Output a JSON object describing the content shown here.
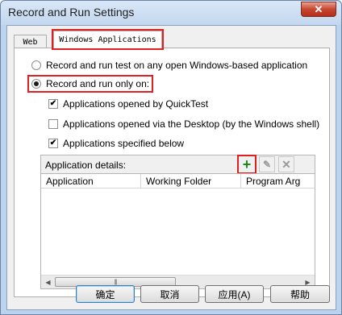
{
  "window": {
    "title": "Record and Run Settings",
    "close_glyph": "✕"
  },
  "tabs": [
    {
      "label": "Web"
    },
    {
      "label": "Windows Applications"
    }
  ],
  "options": {
    "radio_any": "Record and run test on any open Windows-based application",
    "radio_only": "Record and run only on:",
    "check_quicktest": "Applications opened by QuickTest",
    "check_desktop": "Applications opened via the Desktop (by the Windows shell)",
    "check_specified": "Applications specified below",
    "check_quicktest_checked": true,
    "check_desktop_checked": false,
    "check_specified_checked": true,
    "selected_radio": "only"
  },
  "details": {
    "label": "Application details:",
    "columns": [
      "Application",
      "Working Folder",
      "Program Arg"
    ],
    "rows": []
  },
  "toolbar": {
    "add_icon": "+",
    "edit_icon": "✎",
    "delete_icon": "✕"
  },
  "buttons": {
    "ok": "确定",
    "cancel": "取消",
    "apply": "应用(A)",
    "help": "帮助"
  },
  "colors": {
    "highlight": "#e02020",
    "add_icon": "#1a8a1a"
  }
}
